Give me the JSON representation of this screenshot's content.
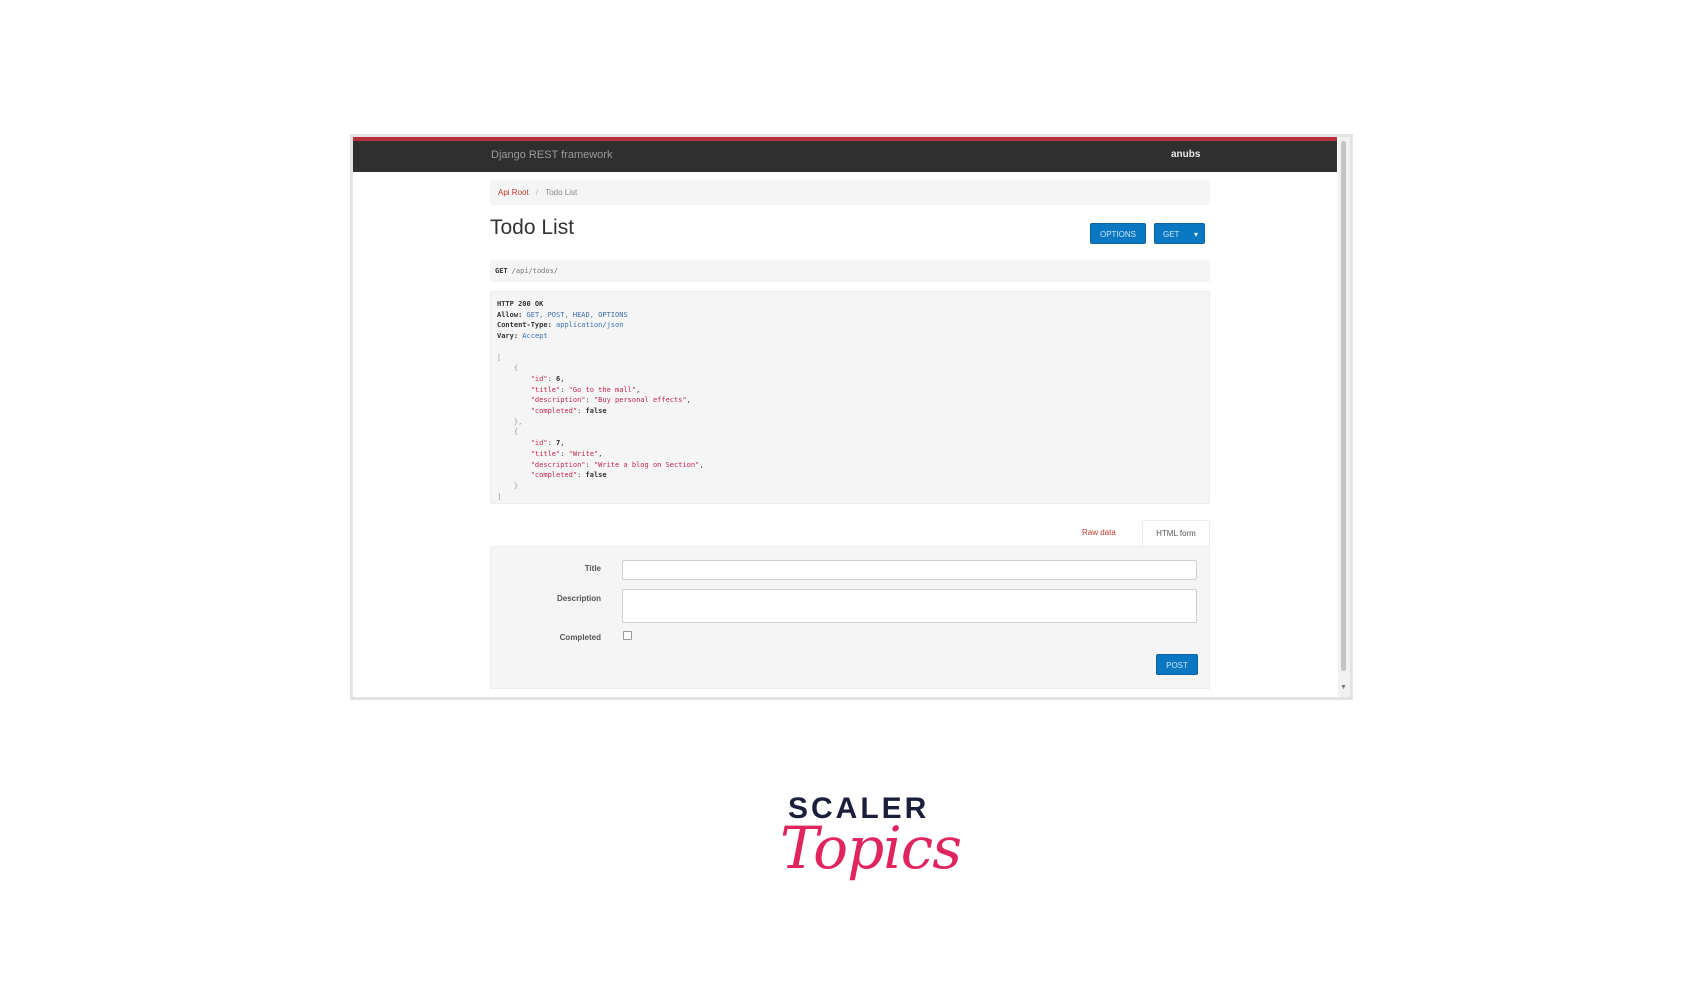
{
  "navbar": {
    "brand": "Django REST framework",
    "user": "anubs"
  },
  "breadcrumb": {
    "root": "Api Root",
    "separator": "/",
    "current": "Todo List"
  },
  "page": {
    "title": "Todo List"
  },
  "buttons": {
    "options": "OPTIONS",
    "get": "GET",
    "get_caret": "▾",
    "post": "POST"
  },
  "request": {
    "method": "GET",
    "path": "/api/todos/"
  },
  "response": {
    "status": "HTTP 200 OK",
    "headers": [
      {
        "key": "Allow:",
        "value": "GET, POST, HEAD, OPTIONS"
      },
      {
        "key": "Content-Type:",
        "value": "application/json"
      },
      {
        "key": "Vary:",
        "value": "Accept"
      }
    ],
    "items": [
      {
        "id": "6",
        "title": "\"Go to the mall\"",
        "description": "\"Buy personal effects\"",
        "completed": "false"
      },
      {
        "id": "7",
        "title": "\"Write\"",
        "description": "\"Write a blog on Section\"",
        "completed": "false"
      }
    ]
  },
  "form": {
    "tabs": {
      "raw": "Raw data",
      "html": "HTML form"
    },
    "labels": {
      "title": "Title",
      "description": "Description",
      "completed": "Completed"
    },
    "values": {
      "title": "",
      "description": ""
    }
  },
  "logo": {
    "top": "SCALER",
    "bottom": "Topics"
  },
  "colors": {
    "navbar": "#2f2f2f",
    "accent": "#b8303a",
    "button": "#0a77c3",
    "logo_pink": "#e0245e",
    "logo_navy": "#1b1f3b"
  }
}
